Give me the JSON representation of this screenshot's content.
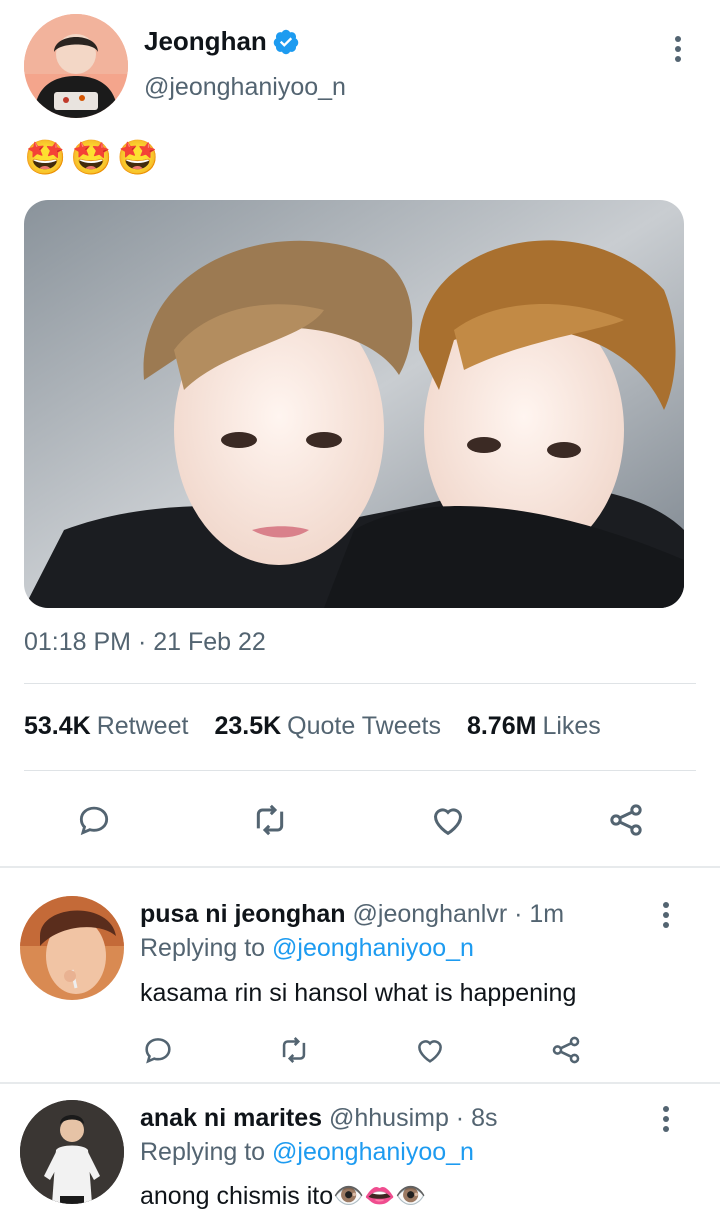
{
  "tweet": {
    "display_name": "Jeonghan",
    "handle": "@jeonghaniyoo_n",
    "emojis": [
      "🤩",
      "🤩",
      "🤩"
    ],
    "timestamp": "01:18 PM · 21 Feb 22",
    "stats": [
      {
        "value": "53.4K",
        "label": "Retweet"
      },
      {
        "value": "23.5K",
        "label": "Quote Tweets"
      },
      {
        "value": "8.76M",
        "label": "Likes"
      }
    ],
    "icons": [
      "reply-icon",
      "retweet-icon",
      "like-icon",
      "share-icon",
      "more-icon",
      "verified-badge-icon"
    ]
  },
  "replies": [
    {
      "name": "pusa ni jeonghan",
      "handle": "@jeonghanlvr",
      "time": "1m",
      "replying_prefix": "Replying to ",
      "replying_to": "@jeonghaniyoo_n",
      "text": "kasama rin si hansol what is happening"
    },
    {
      "name": "anak ni marites",
      "handle": "@hhusimp",
      "time": "8s",
      "replying_prefix": "Replying to ",
      "replying_to": "@jeonghaniyoo_n",
      "text": "anong chismis ito",
      "emojis": "👁️👄👁️"
    }
  ],
  "colors": {
    "accent": "#1d9bf0",
    "text": "#0f1419",
    "secondary": "#536471",
    "divider": "#dfe3e6"
  }
}
